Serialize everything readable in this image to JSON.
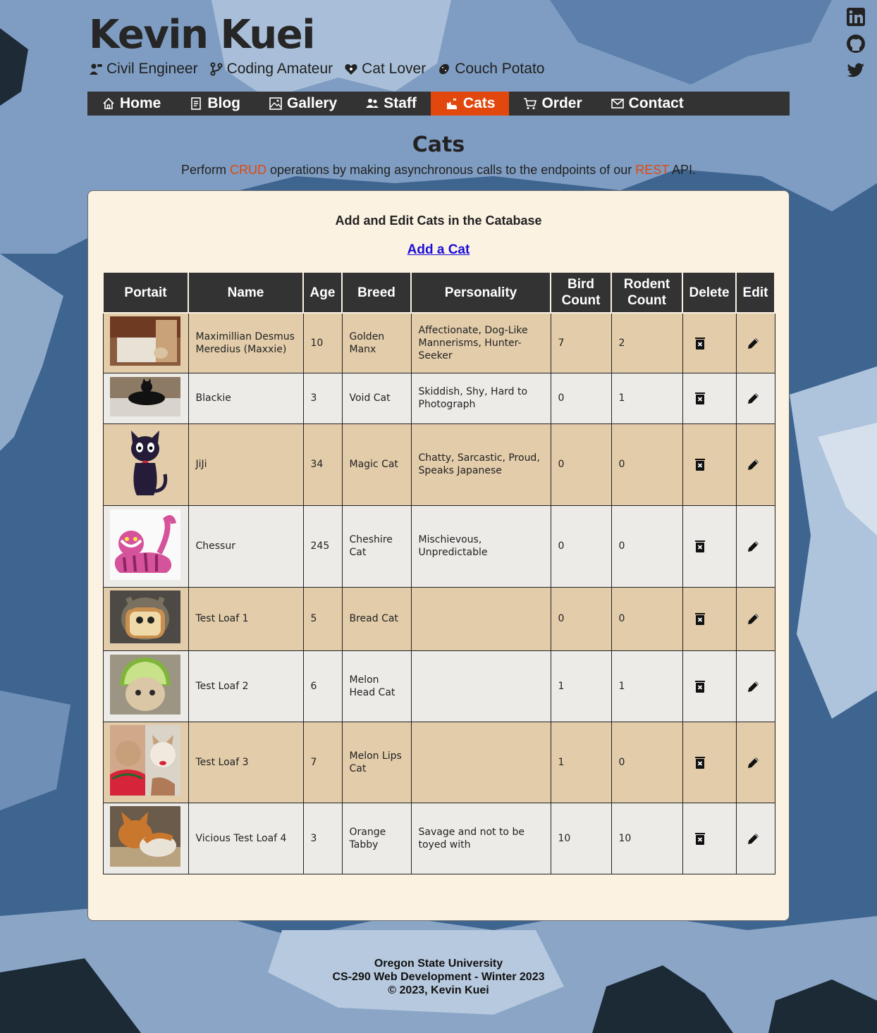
{
  "header": {
    "title": "Kevin Kuei",
    "tags": [
      {
        "icon": "engineer-icon",
        "label": "Civil Engineer"
      },
      {
        "icon": "branch-icon",
        "label": "Coding Amateur"
      },
      {
        "icon": "heart-paw-icon",
        "label": "Cat Lover"
      },
      {
        "icon": "potato-icon",
        "label": "Couch Potato"
      }
    ]
  },
  "social": [
    "linkedin-icon",
    "github-icon",
    "twitter-icon"
  ],
  "nav": [
    {
      "icon": "home-icon",
      "label": "Home"
    },
    {
      "icon": "blog-icon",
      "label": "Blog"
    },
    {
      "icon": "gallery-icon",
      "label": "Gallery"
    },
    {
      "icon": "staff-icon",
      "label": "Staff"
    },
    {
      "icon": "cat-icon",
      "label": "Cats",
      "active": true
    },
    {
      "icon": "cart-icon",
      "label": "Order"
    },
    {
      "icon": "mail-icon",
      "label": "Contact"
    }
  ],
  "page": {
    "heading": "Cats",
    "intro_pre": "Perform ",
    "intro_crud": "CRUD",
    "intro_mid": " operations by making asynchronous calls to the endpoints of our ",
    "intro_rest": "REST",
    "intro_post": " API."
  },
  "card": {
    "title": "Add and Edit Cats in the Catabase",
    "add_link": "Add a Cat"
  },
  "table": {
    "headers": [
      "Portait",
      "Name",
      "Age",
      "Breed",
      "Personality",
      "Bird Count",
      "Rodent Count",
      "Delete",
      "Edit"
    ],
    "rows": [
      {
        "name": "Maximillian Desmus Meredius (Maxxie)",
        "age": "10",
        "breed": "Golden Manx",
        "personality": "Affectionate, Dog-Like Mannerisms, Hunter-Seeker",
        "bird": "7",
        "rodent": "2"
      },
      {
        "name": "Blackie",
        "age": "3",
        "breed": "Void Cat",
        "personality": "Skiddish, Shy, Hard to Photograph",
        "bird": "0",
        "rodent": "1"
      },
      {
        "name": "JiJi",
        "age": "34",
        "breed": "Magic Cat",
        "personality": "Chatty, Sarcastic, Proud, Speaks Japanese",
        "bird": "0",
        "rodent": "0"
      },
      {
        "name": "Chessur",
        "age": "245",
        "breed": "Cheshire Cat",
        "personality": "Mischievous, Unpredictable",
        "bird": "0",
        "rodent": "0"
      },
      {
        "name": "Test Loaf 1",
        "age": "5",
        "breed": "Bread Cat",
        "personality": "",
        "bird": "0",
        "rodent": "0"
      },
      {
        "name": "Test Loaf 2",
        "age": "6",
        "breed": "Melon Head Cat",
        "personality": "",
        "bird": "1",
        "rodent": "1"
      },
      {
        "name": "Test Loaf 3",
        "age": "7",
        "breed": "Melon Lips Cat",
        "personality": "",
        "bird": "1",
        "rodent": "0"
      },
      {
        "name": "Vicious Test Loaf 4",
        "age": "3",
        "breed": "Orange Tabby",
        "personality": "Savage and not to be toyed with",
        "bird": "10",
        "rodent": "10"
      }
    ]
  },
  "footer": {
    "line1": "Oregon State University",
    "line2": "CS-290 Web Development - Winter 2023",
    "line3": "© 2023, Kevin Kuei"
  }
}
